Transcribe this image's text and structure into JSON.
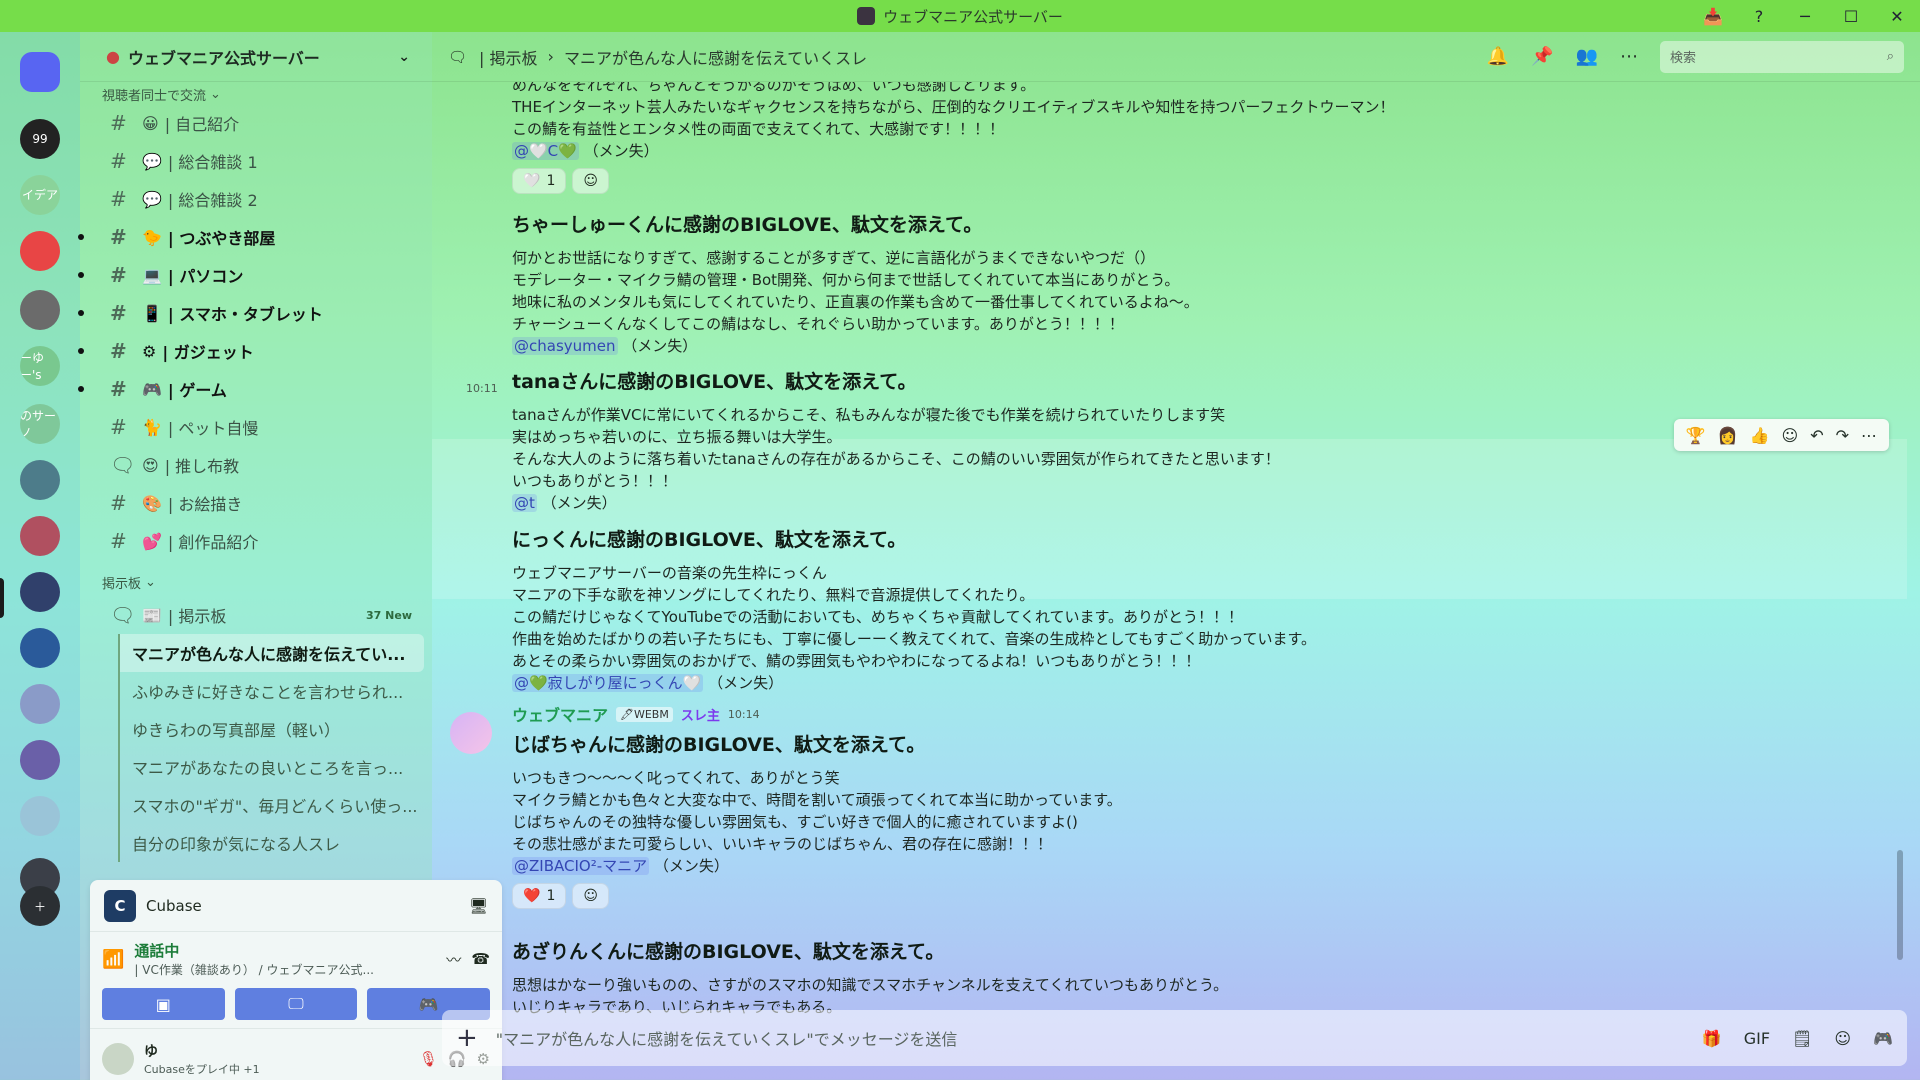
{
  "window": {
    "title": "ウェブマニア公式サーバー",
    "controls": [
      "─",
      "☐",
      "✕"
    ],
    "tools": [
      "📥",
      "?"
    ]
  },
  "guilds": [
    {
      "label": "",
      "icon": "discord-home-icon",
      "bg": "#5865f2"
    },
    {
      "label": "99",
      "bg": "#222"
    },
    {
      "label": "イデア",
      "bg": "#8ad39a"
    },
    {
      "label": "",
      "icon": "discord-icon",
      "bg": "#e84545"
    },
    {
      "label": "",
      "bg": "#6b6b6b"
    },
    {
      "label": "ーゆー's",
      "bg": "#79c88f"
    },
    {
      "label": "のサーノ",
      "bg": "#7fc89a"
    },
    {
      "label": "",
      "bg": "#4d7c8a"
    },
    {
      "label": "",
      "bg": "#b05060"
    },
    {
      "label": "",
      "bg": "#30406b"
    },
    {
      "label": "",
      "bg": "#2a5a9a"
    },
    {
      "label": "",
      "bg": "#8a9bc8"
    },
    {
      "label": "",
      "bg": "#6a60a8"
    },
    {
      "label": "",
      "bg": "#9ac4d8"
    },
    {
      "label": "",
      "bg": "#3b3f48"
    }
  ],
  "server": {
    "name": "ウェブマニア公式サーバー",
    "category1": "視聴者同士で交流",
    "category2": "掲示板"
  },
  "channels": [
    {
      "hash": "#",
      "emoji": "😀",
      "name": "| 自己紹介",
      "unread": false
    },
    {
      "hash": "#",
      "emoji": "💬",
      "name": "| 総合雑談 1",
      "unread": false
    },
    {
      "hash": "#",
      "emoji": "💬",
      "name": "| 総合雑談 2",
      "unread": false
    },
    {
      "hash": "#",
      "emoji": "🐤",
      "name": "| つぶやき部屋",
      "unread": true
    },
    {
      "hash": "#",
      "emoji": "💻",
      "name": "| パソコン",
      "unread": true
    },
    {
      "hash": "#",
      "emoji": "📱",
      "name": "| スマホ・タブレット",
      "unread": true
    },
    {
      "hash": "#",
      "emoji": "⚙",
      "name": "| ガジェット",
      "unread": true
    },
    {
      "hash": "#",
      "emoji": "🎮",
      "name": "| ゲーム",
      "unread": true
    },
    {
      "hash": "#",
      "emoji": "🐈",
      "name": "| ペット自慢",
      "unread": false
    },
    {
      "hash": "🗨",
      "emoji": "😍",
      "name": "| 推し布教",
      "unread": false
    },
    {
      "hash": "#",
      "emoji": "🎨",
      "name": "| お絵描き",
      "unread": false
    },
    {
      "hash": "#",
      "emoji": "💕",
      "name": "| 創作品紹介",
      "unread": false
    }
  ],
  "forum": {
    "hash": "🗨",
    "emoji": "📰",
    "name": "| 掲示板",
    "badge": "37 New"
  },
  "threads": [
    "マニアが色んな人に感謝を伝えてい...",
    "ふゆみきに好きなことを言わせられ...",
    "ゆきらわの写真部屋（軽い）",
    "マニアがあなたの良いところを言っ...",
    "スマホの\"ギガ\"、毎月どんくらい使っ...",
    "自分の印象が気になる人スレ"
  ],
  "activity": {
    "app": "Cubase",
    "logo": "C"
  },
  "voice": {
    "status": "通話中",
    "channel": "| VC作業（雑談あり） / ウェブマニア公式..."
  },
  "user": {
    "name": "ゆ",
    "status": "Cubaseをプレイ中 +1"
  },
  "header": {
    "forum": "| 掲示板",
    "sep": "›",
    "thread": "マニアが色んな人に感謝を伝えていくスレ",
    "search_placeholder": "検索"
  },
  "top_msg": {
    "lines": [
      "めんなをそれぞれ、ちゃんとそうかるのがそうはめ、いつも感謝しとります。",
      "THEインターネット芸人みたいなギャクセンスを持ちながら、圧倒的なクリエイティブスキルや知性を持つパーフェクトウーマン！",
      "この鯖を有益性とエンタメ性の両面で支えてくれて、大感謝です！！！！"
    ],
    "mention": "@🤍C💚",
    "suffix": "（メン失）",
    "reaction": "🤍",
    "reaction_count": "1"
  },
  "msgs": [
    {
      "title": "ちゃーしゅーくんに感謝のBIGLOVE、駄文を添えて。",
      "lines": [
        "何かとお世話になりすぎて、感謝することが多すぎて、逆に言語化がうまくできないやつだ（）",
        "モデレーター・マイクラ鯖の管理・Bot開発、何から何まで世話してくれていて本当にありがとう。",
        "地味に私のメンタルも気にしてくれていたり、正直裏の作業も含めて一番仕事してくれているよね〜。",
        "チャーシューくんなくしてこの鯖はなし、それぐらい助かっています。ありがとう！！！！"
      ],
      "mention": "@chasyumen",
      "suffix": "（メン失）"
    },
    {
      "time": "10:11",
      "title": "tanaさんに感謝のBIGLOVE、駄文を添えて。",
      "lines": [
        "tanaさんが作業VCに常にいてくれるからこそ、私もみんなが寝た後でも作業を続けられていたりします笑",
        "実はめっちゃ若いのに、立ち振る舞いは大学生。",
        "そんな大人のように落ち着いたtanaさんの存在があるからこそ、この鯖のいい雰囲気が作られてきたと思います！",
        "いつもありがとう！！！"
      ],
      "mention": "@t",
      "suffix": "（メン失）"
    },
    {
      "title": "にっくんに感謝のBIGLOVE、駄文を添えて。",
      "lines": [
        "ウェブマニアサーバーの音楽の先生枠にっくん",
        "マニアの下手な歌を神ソングにしてくれたり、無料で音源提供してくれたり。",
        "この鯖だけじゃなくてYouTubeでの活動においても、めちゃくちゃ貢献してくれています。ありがとう！！！",
        "作曲を始めたばかりの若い子たちにも、丁寧に優しーーく教えてくれて、音楽の生成枠としてもすごく助かっています。",
        "あとその柔らかい雰囲気のおかげで、鯖の雰囲気もやわやわになってるよね！いつもありがとう！！！"
      ],
      "mention": "@💚寂しがり屋にっくん🤍",
      "suffix": "（メン失）"
    },
    {
      "author": "ウェブマニア",
      "tag": "🖊WEBM",
      "op": "スレ主",
      "time": "10:14",
      "title": "じばちゃんに感謝のBIGLOVE、駄文を添えて。",
      "lines": [
        "いつもきつ〜〜〜く叱ってくれて、ありがとう笑",
        "マイクラ鯖とかも色々と大変な中で、時間を割いて頑張ってくれて本当に助かっています。",
        "じばちゃんのその独特な優しい雰囲気も、すごい好きで個人的に癒されていますよ()",
        "その悲壮感がまた可愛らしい、いいキャラのじばちゃん、君の存在に感謝！！！"
      ],
      "mention": "@ZIBACIO²-マニア",
      "suffix": "（メン失）",
      "reaction": "❤️",
      "reaction_count": "1"
    },
    {
      "title": "あざりんくんに感謝のBIGLOVE、駄文を添えて。",
      "lines": [
        "思想はかなーり強いものの、さすがのスマホの知識でスマホチャンネルを支えてくれていつもありがとう。",
        "いじりキャラであり、いじられキャラでもある。"
      ]
    }
  ],
  "toolbar": [
    "🏆",
    "👩",
    "👍",
    "☺",
    "↶",
    "↷",
    "⋯"
  ],
  "composer": {
    "placeholder": "\"マニアが色んな人に感謝を伝えていくスレ\"でメッセージを送信",
    "icons": [
      "🎁",
      "GIF",
      "🗒",
      "☺",
      "🎮"
    ]
  }
}
